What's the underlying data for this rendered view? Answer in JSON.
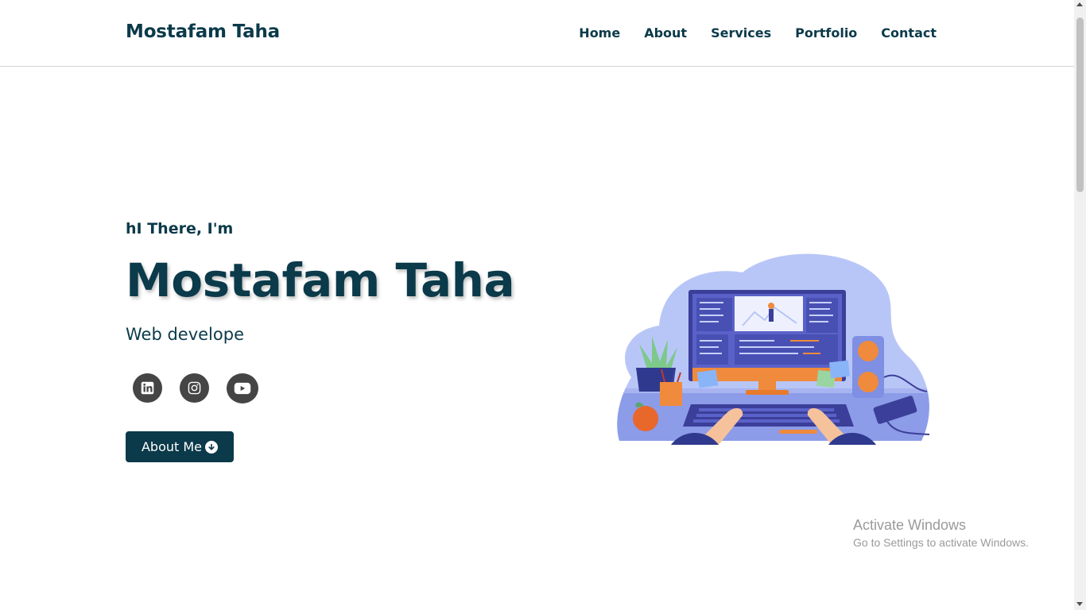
{
  "site": {
    "brand": "Mostafam Taha",
    "nav": [
      "Home",
      "About",
      "Services",
      "Portfolio",
      "Contact"
    ],
    "scroll_progress": 0.2
  },
  "hero": {
    "greeting": "hI There, I'm",
    "name": "Mostafam Taha",
    "role": "Web develope",
    "socials": [
      {
        "icon": "linkedin-icon"
      },
      {
        "icon": "instagram-icon"
      },
      {
        "icon": "youtube-icon"
      }
    ],
    "cta_label": "About Me"
  },
  "os_watermark": {
    "title": "Activate Windows",
    "subtitle": "Go to Settings to activate Windows."
  },
  "colors": {
    "primary": "#0b3a4a",
    "social_bg": "#454545",
    "accent_blue": "#1f5fa8"
  }
}
